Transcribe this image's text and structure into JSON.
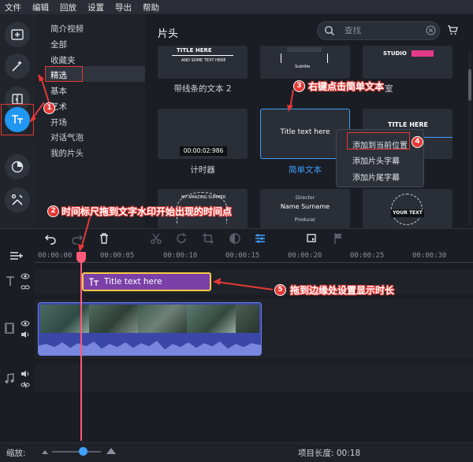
{
  "menu": [
    "文件",
    "编辑",
    "回放",
    "设置",
    "导出",
    "帮助"
  ],
  "categories": [
    "简介视频",
    "全部",
    "收藏夹",
    "精选",
    "基本",
    "艺术",
    "开场",
    "对话气泡",
    "我的片头"
  ],
  "main": {
    "title": "片头",
    "search_placeholder": "查找"
  },
  "tiles": [
    {
      "label": "",
      "art": "TITLE HERE"
    },
    {
      "label": "",
      "art": "Subtitle"
    },
    {
      "label": "",
      "art": "STUDIO"
    },
    {
      "label": "带线条的文本 2",
      "art": ""
    },
    {
      "label": "计时器",
      "art": "00:00:02:986"
    },
    {
      "label": "简单文本",
      "art": "Title text here"
    },
    {
      "label": "",
      "art": "TITLE HERE"
    },
    {
      "label": "",
      "art": "MY AMAZING SUMMER"
    },
    {
      "label": "",
      "art": "Director"
    },
    {
      "label": "",
      "art": "Name Surname"
    },
    {
      "label": "",
      "art": "Producer"
    },
    {
      "label": "",
      "art": "YOUR TEXT"
    }
  ],
  "partial_label": "室",
  "context_menu": [
    "添加到当前位置",
    "添加片头字幕",
    "添加片尾字幕"
  ],
  "annotations": [
    {
      "n": "1",
      "text": ""
    },
    {
      "n": "2",
      "text": "时间标尺拖到文字水印开始出现的时间点"
    },
    {
      "n": "3",
      "text": "右键点击简单文本"
    },
    {
      "n": "4",
      "text": ""
    },
    {
      "n": "5",
      "text": "拖到边缘处设置显示时长"
    }
  ],
  "ruler_ticks": [
    "00:00:00",
    "00:00:05",
    "00:00:10",
    "00:00:15",
    "00:00:20",
    "00:00:25",
    "00:00:30"
  ],
  "text_clip_label": "Title text here",
  "bottom": {
    "zoom_label": "缩放:",
    "project_length": "项目长度: 00:18"
  },
  "colors": {
    "accent": "#2196f3",
    "annotation": "#e53935",
    "text_clip": "#7b3fa8",
    "clip_border": "#f7c948",
    "playhead": "#ff5a7a"
  }
}
